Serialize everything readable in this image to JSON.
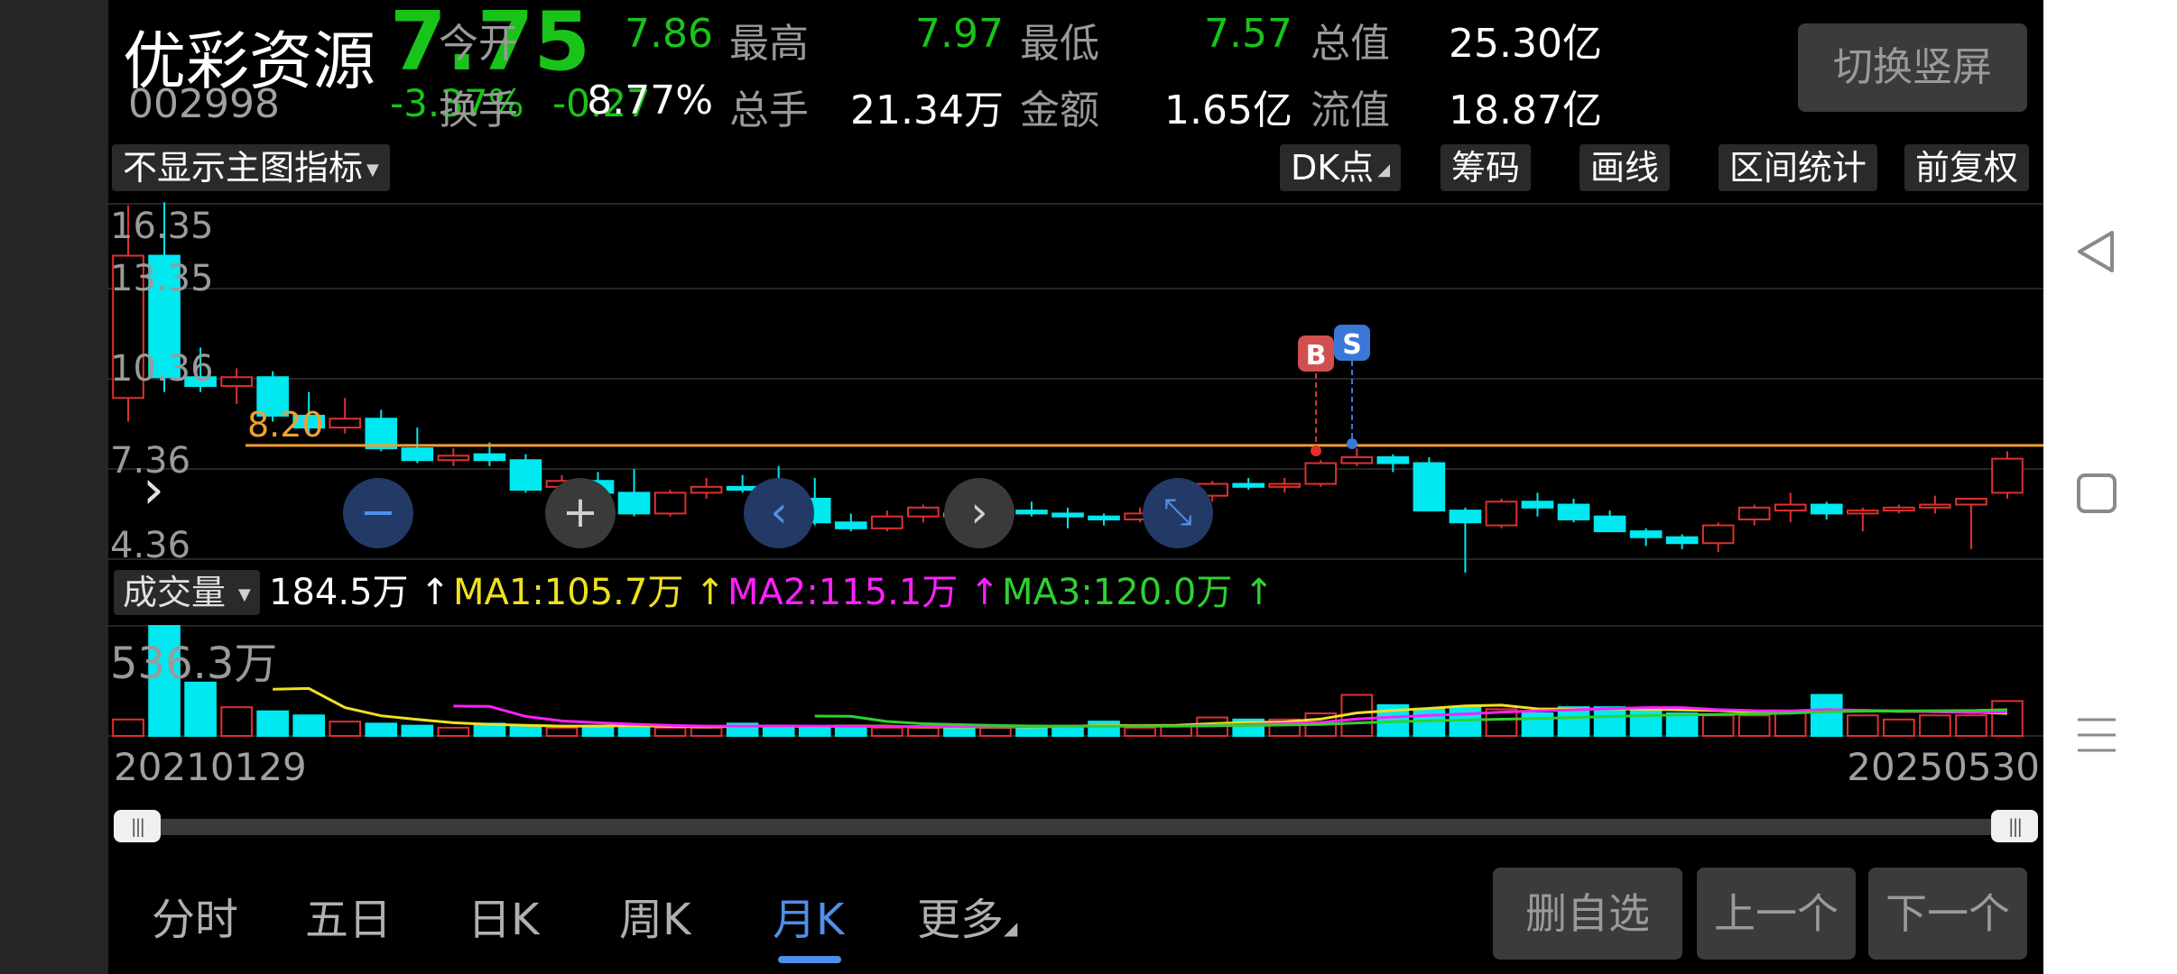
{
  "header": {
    "name": "优彩资源",
    "code": "002998",
    "price": "7.75",
    "change_pct": "-3.37%",
    "change_amt": "-0.27",
    "quotes": [
      {
        "label": "今开",
        "value": "7.86",
        "color": "green"
      },
      {
        "label": "最高",
        "value": "7.97",
        "color": "green"
      },
      {
        "label": "最低",
        "value": "7.57",
        "color": "green"
      },
      {
        "label": "总值",
        "value": "25.30亿",
        "color": "white"
      },
      {
        "label": "换手",
        "value": "8.77%",
        "color": "white"
      },
      {
        "label": "总手",
        "value": "21.34万",
        "color": "white"
      },
      {
        "label": "金额",
        "value": "1.65亿",
        "color": "white"
      },
      {
        "label": "流值",
        "value": "18.87亿",
        "color": "white"
      }
    ],
    "switch_button": "切换竖屏"
  },
  "toolbar": {
    "indicator_select": "不显示主图指标",
    "dk_point": "DK点",
    "chips": "筹码",
    "draw_line": "画线",
    "range_stats": "区间统计",
    "adjust": "前复权"
  },
  "chart": {
    "price_axis": [
      "16.35",
      "13.35",
      "10.36",
      "7.36",
      "4.36"
    ],
    "reference_line_label": "8.20",
    "marker_buy": "B",
    "marker_sell": "S",
    "colors": {
      "up": "#e03030",
      "down": "#00e8f0",
      "ref_line": "#f0a030",
      "ma1": "#f0e020",
      "ma2": "#ff20ff",
      "ma3": "#30d030"
    }
  },
  "chart_data": {
    "type": "candlestick",
    "period": "monthly",
    "date_range": [
      "20210129",
      "20250530"
    ],
    "reference_price": 8.2,
    "ylim": [
      4.36,
      16.35
    ],
    "ohlc": [
      [
        9.8,
        16.3,
        9.0,
        14.6
      ],
      [
        14.6,
        16.4,
        10.0,
        10.5
      ],
      [
        10.5,
        11.5,
        10.0,
        10.2
      ],
      [
        10.2,
        10.8,
        9.6,
        10.5
      ],
      [
        10.5,
        10.7,
        9.0,
        9.2
      ],
      [
        9.2,
        10.0,
        8.6,
        8.8
      ],
      [
        8.8,
        9.8,
        8.6,
        9.1
      ],
      [
        9.1,
        9.4,
        8.0,
        8.1
      ],
      [
        8.1,
        8.8,
        7.6,
        7.7
      ],
      [
        7.7,
        8.1,
        7.5,
        7.85
      ],
      [
        7.9,
        8.3,
        7.5,
        7.7
      ],
      [
        7.7,
        7.9,
        6.6,
        6.7
      ],
      [
        6.8,
        7.2,
        6.5,
        7.0
      ],
      [
        7.0,
        7.3,
        6.4,
        6.6
      ],
      [
        6.6,
        7.4,
        5.8,
        5.9
      ],
      [
        5.9,
        6.7,
        5.8,
        6.6
      ],
      [
        6.6,
        7.1,
        6.4,
        6.8
      ],
      [
        6.8,
        7.2,
        6.6,
        6.7
      ],
      [
        6.7,
        7.5,
        6.3,
        6.4
      ],
      [
        6.4,
        7.1,
        5.5,
        5.6
      ],
      [
        5.6,
        5.9,
        5.3,
        5.4
      ],
      [
        5.4,
        6.0,
        5.3,
        5.8
      ],
      [
        5.8,
        6.2,
        5.6,
        6.1
      ],
      [
        5.9,
        6.6,
        5.4,
        5.8
      ],
      [
        5.8,
        6.2,
        5.6,
        6.0
      ],
      [
        6.0,
        6.3,
        5.8,
        5.9
      ],
      [
        5.9,
        6.1,
        5.4,
        5.8
      ],
      [
        5.8,
        5.9,
        5.5,
        5.7
      ],
      [
        5.7,
        6.1,
        5.6,
        5.9
      ],
      [
        5.9,
        6.6,
        5.8,
        6.5
      ],
      [
        6.5,
        7.0,
        6.3,
        6.9
      ],
      [
        6.9,
        7.1,
        6.7,
        6.8
      ],
      [
        6.8,
        7.1,
        6.6,
        6.9
      ],
      [
        6.9,
        7.7,
        6.8,
        7.6
      ],
      [
        7.6,
        8.1,
        7.5,
        7.8
      ],
      [
        7.8,
        7.9,
        7.3,
        7.6
      ],
      [
        7.6,
        7.8,
        6.0,
        6.0
      ],
      [
        6.0,
        6.1,
        3.9,
        5.6
      ],
      [
        5.5,
        6.4,
        5.4,
        6.3
      ],
      [
        6.3,
        6.6,
        5.8,
        6.1
      ],
      [
        6.2,
        6.4,
        5.6,
        5.7
      ],
      [
        5.8,
        6.0,
        5.3,
        5.3
      ],
      [
        5.3,
        5.4,
        4.8,
        5.1
      ],
      [
        5.1,
        5.2,
        4.7,
        4.9
      ],
      [
        4.9,
        5.6,
        4.6,
        5.5
      ],
      [
        5.7,
        6.2,
        5.5,
        6.1
      ],
      [
        6.0,
        6.6,
        5.6,
        6.2
      ],
      [
        6.2,
        6.3,
        5.7,
        5.9
      ],
      [
        5.9,
        6.1,
        5.3,
        6.0
      ],
      [
        6.0,
        6.2,
        5.9,
        6.1
      ],
      [
        6.1,
        6.5,
        5.9,
        6.2
      ],
      [
        6.2,
        6.4,
        4.7,
        6.4
      ],
      [
        6.6,
        8.0,
        6.4,
        7.75
      ]
    ],
    "volume": {
      "ylim_max_wan": 536.3,
      "current_wan": 184.5,
      "ma1": 105.7,
      "ma2": 115.1,
      "ma3": 120.0,
      "bars": [
        80,
        536,
        260,
        140,
        120,
        100,
        70,
        60,
        50,
        40,
        60,
        50,
        40,
        50,
        50,
        40,
        40,
        60,
        50,
        40,
        50,
        40,
        40,
        50,
        40,
        50,
        50,
        70,
        40,
        50,
        90,
        80,
        80,
        110,
        200,
        150,
        130,
        140,
        130,
        110,
        140,
        140,
        130,
        110,
        100,
        100,
        120,
        200,
        100,
        80,
        100,
        100,
        170
      ]
    }
  },
  "volume_legend": {
    "selector": "成交量",
    "current": "184.5万",
    "ma1": "MA1:105.7万",
    "ma2": "MA2:115.1万",
    "ma3": "MA3:120.0万",
    "arrow": "↑",
    "axis_max": "536.3万"
  },
  "dates": {
    "start": "20210129",
    "end": "20250530"
  },
  "tabs": [
    "分时",
    "五日",
    "日K",
    "周K",
    "月K",
    "更多"
  ],
  "active_tab": "月K",
  "bottom_buttons": {
    "delete": "删自选",
    "prev": "上一个",
    "next": "下一个"
  }
}
